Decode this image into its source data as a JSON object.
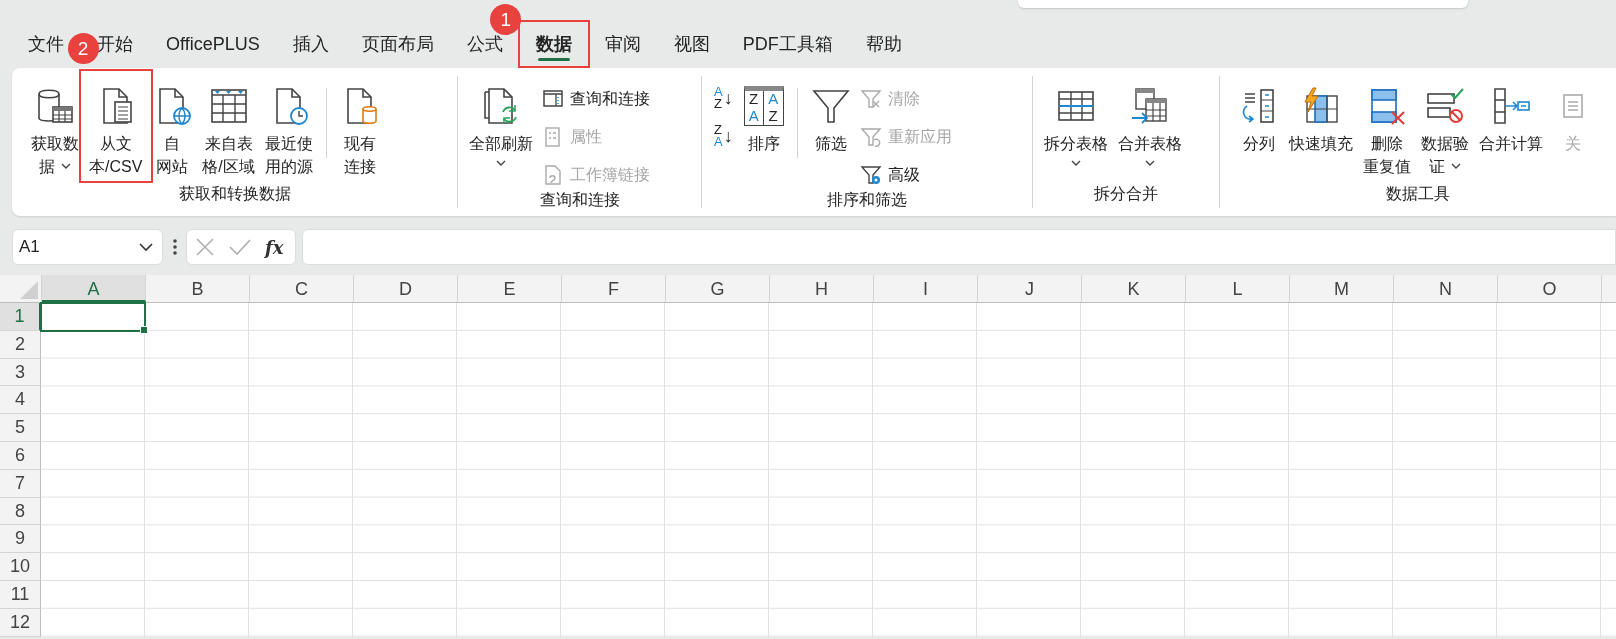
{
  "tabs": [
    {
      "label": "文件",
      "selected": false
    },
    {
      "label": "开始",
      "selected": false
    },
    {
      "label": "OfficePLUS",
      "selected": false
    },
    {
      "label": "插入",
      "selected": false
    },
    {
      "label": "页面布局",
      "selected": false
    },
    {
      "label": "公式",
      "selected": false
    },
    {
      "label": "数据",
      "selected": true,
      "annotation": "1"
    },
    {
      "label": "审阅",
      "selected": false
    },
    {
      "label": "视图",
      "selected": false
    },
    {
      "label": "PDF工具箱",
      "selected": false
    },
    {
      "label": "帮助",
      "selected": false
    }
  ],
  "ribbon": {
    "groups": [
      {
        "label": "获取和转换数据",
        "items": [
          {
            "kind": "large",
            "lines": [
              "获取数",
              "据"
            ],
            "dropdown": true,
            "disabled": false
          },
          {
            "kind": "large",
            "lines": [
              "从文",
              "本/CSV"
            ],
            "dropdown": false,
            "disabled": false,
            "annotation": "2"
          },
          {
            "kind": "large",
            "lines": [
              "自",
              "网站"
            ],
            "dropdown": false,
            "disabled": false
          },
          {
            "kind": "large",
            "lines": [
              "来自表",
              "格/区域"
            ],
            "dropdown": false,
            "disabled": false
          },
          {
            "kind": "large",
            "lines": [
              "最近使",
              "用的源"
            ],
            "dropdown": false,
            "disabled": false
          },
          {
            "kind": "separator"
          },
          {
            "kind": "large",
            "lines": [
              "现有",
              "连接"
            ],
            "dropdown": false,
            "disabled": false
          }
        ]
      },
      {
        "label": "查询和连接",
        "items": [
          {
            "kind": "large",
            "lines": [
              "全部刷新"
            ],
            "dropdown": true,
            "disabled": false
          },
          {
            "kind": "stack",
            "items": [
              {
                "label": "查询和连接",
                "disabled": false
              },
              {
                "label": "属性",
                "disabled": true
              },
              {
                "label": "工作簿链接",
                "disabled": true
              }
            ]
          }
        ]
      },
      {
        "label": "排序和筛选",
        "items": [
          {
            "kind": "sortstack",
            "items": [
              {
                "letters": [
                  "A",
                  "Z"
                ],
                "arrow": "↓"
              },
              {
                "letters": [
                  "Z",
                  "A"
                ],
                "arrow": "↓"
              }
            ]
          },
          {
            "kind": "large",
            "lines": [
              "排序"
            ],
            "icon_letters": [
              "Z",
              "A",
              "A",
              "Z"
            ],
            "dropdown": false,
            "disabled": false
          },
          {
            "kind": "separator"
          },
          {
            "kind": "large",
            "lines": [
              "筛选"
            ],
            "dropdown": false,
            "disabled": false
          },
          {
            "kind": "stack",
            "items": [
              {
                "label": "清除",
                "disabled": true
              },
              {
                "label": "重新应用",
                "disabled": true
              },
              {
                "label": "高级",
                "disabled": false
              }
            ]
          }
        ]
      },
      {
        "label": "拆分合并",
        "items": [
          {
            "kind": "large",
            "lines": [
              "拆分表格"
            ],
            "dropdown": true,
            "disabled": false
          },
          {
            "kind": "large",
            "lines": [
              "合并表格"
            ],
            "dropdown": true,
            "disabled": false
          }
        ]
      },
      {
        "label": "数据工具",
        "items": [
          {
            "kind": "large",
            "lines": [
              "分列"
            ],
            "dropdown": false,
            "disabled": false
          },
          {
            "kind": "large",
            "lines": [
              "快速填充"
            ],
            "dropdown": false,
            "disabled": false
          },
          {
            "kind": "large",
            "lines": [
              "删除",
              "重复值"
            ],
            "dropdown": false,
            "disabled": false
          },
          {
            "kind": "large",
            "lines": [
              "数据验",
              "证"
            ],
            "dropdown": true,
            "disabled": false
          },
          {
            "kind": "large",
            "lines": [
              "合并计算"
            ],
            "dropdown": false,
            "disabled": false
          },
          {
            "kind": "large",
            "lines": [
              "关"
            ],
            "dropdown": false,
            "disabled": true
          }
        ]
      }
    ]
  },
  "formula_bar": {
    "name_box": "A1",
    "function_label": "fx",
    "cancel_disabled": true,
    "enter_disabled": true
  },
  "grid": {
    "columns": [
      {
        "label": "A",
        "selected": true
      },
      {
        "label": "B",
        "selected": false
      },
      {
        "label": "C",
        "selected": false
      },
      {
        "label": "D",
        "selected": false
      },
      {
        "label": "E",
        "selected": false
      },
      {
        "label": "F",
        "selected": false
      },
      {
        "label": "G",
        "selected": false
      },
      {
        "label": "H",
        "selected": false
      },
      {
        "label": "I",
        "selected": false
      },
      {
        "label": "J",
        "selected": false
      },
      {
        "label": "K",
        "selected": false
      },
      {
        "label": "L",
        "selected": false
      },
      {
        "label": "M",
        "selected": false
      },
      {
        "label": "N",
        "selected": false
      },
      {
        "label": "O",
        "selected": false
      }
    ],
    "rows": [
      {
        "label": "1",
        "selected": true
      },
      {
        "label": "2",
        "selected": false
      },
      {
        "label": "3",
        "selected": false
      },
      {
        "label": "4",
        "selected": false
      },
      {
        "label": "5",
        "selected": false
      },
      {
        "label": "6",
        "selected": false
      },
      {
        "label": "7",
        "selected": false
      },
      {
        "label": "8",
        "selected": false
      },
      {
        "label": "9",
        "selected": false
      },
      {
        "label": "10",
        "selected": false
      },
      {
        "label": "11",
        "selected": false
      },
      {
        "label": "12",
        "selected": false
      }
    ]
  }
}
